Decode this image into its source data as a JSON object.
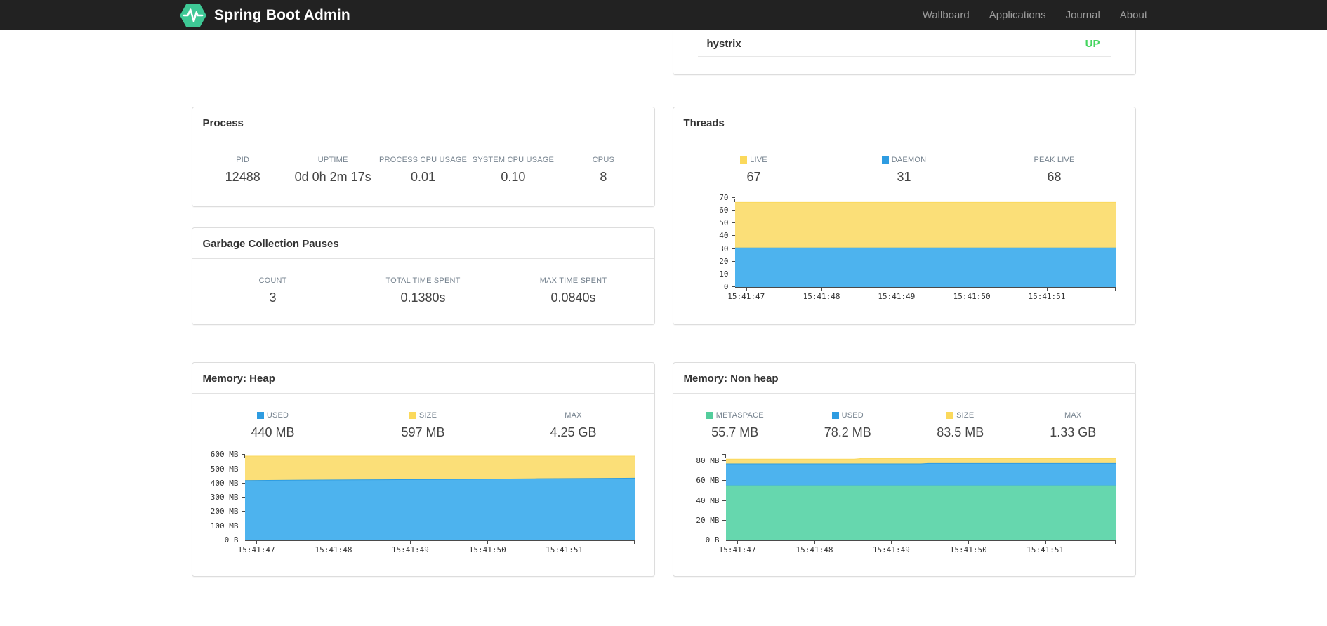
{
  "header": {
    "brand": "Spring Boot Admin",
    "nav": [
      "Wallboard",
      "Applications",
      "Journal",
      "About"
    ]
  },
  "application_panel": {
    "name": "hystrix",
    "status": "UP",
    "status_color": "#45d55f"
  },
  "colors": {
    "navbar_bg": "#222222",
    "brand_green": "#3ec895",
    "status_up": "#45d55f",
    "swatch_yellow": "#fbd95c",
    "swatch_blue": "#2e9ce1",
    "swatch_green": "#53cd9c",
    "area_yellow": "#fbdf78",
    "area_blue": "#4db3ee",
    "area_green": "#66d7ae"
  },
  "panels": {
    "process": {
      "title": "Process",
      "stats": [
        {
          "label": "PID",
          "value": "12488"
        },
        {
          "label": "UPTIME",
          "value": "0d 0h 2m 17s"
        },
        {
          "label": "PROCESS CPU USAGE",
          "value": "0.01"
        },
        {
          "label": "SYSTEM CPU USAGE",
          "value": "0.10"
        },
        {
          "label": "CPUS",
          "value": "8"
        }
      ]
    },
    "gc": {
      "title": "Garbage Collection Pauses",
      "stats": [
        {
          "label": "COUNT",
          "value": "3"
        },
        {
          "label": "TOTAL TIME SPENT",
          "value": "0.1380s"
        },
        {
          "label": "MAX TIME SPENT",
          "value": "0.0840s"
        }
      ]
    },
    "threads": {
      "title": "Threads",
      "stats": [
        {
          "label": "LIVE",
          "value": "67",
          "swatch": "#fbd95c"
        },
        {
          "label": "DAEMON",
          "value": "31",
          "swatch": "#2e9ce1"
        },
        {
          "label": "PEAK LIVE",
          "value": "68"
        }
      ]
    },
    "heap": {
      "title": "Memory: Heap",
      "stats": [
        {
          "label": "USED",
          "value": "440 MB",
          "swatch": "#2e9ce1"
        },
        {
          "label": "SIZE",
          "value": "597 MB",
          "swatch": "#fbd95c"
        },
        {
          "label": "MAX",
          "value": "4.25 GB"
        }
      ]
    },
    "nonheap": {
      "title": "Memory: Non heap",
      "stats": [
        {
          "label": "METASPACE",
          "value": "55.7 MB",
          "swatch": "#53cd9c"
        },
        {
          "label": "USED",
          "value": "78.2 MB",
          "swatch": "#2e9ce1"
        },
        {
          "label": "SIZE",
          "value": "83.5 MB",
          "swatch": "#fbd95c"
        },
        {
          "label": "MAX",
          "value": "1.33 GB"
        }
      ]
    }
  },
  "chart_data": [
    {
      "id": "threads",
      "title": "Threads",
      "type": "area",
      "stacked": true,
      "legend_position": "top",
      "grid": false,
      "x_ticks": [
        "15:41:47",
        "15:41:48",
        "15:41:49",
        "15:41:50",
        "15:41:51"
      ],
      "x_tick_fractions": [
        0.03,
        0.228,
        0.425,
        0.623,
        0.82
      ],
      "ylim": [
        0,
        70
      ],
      "scale_max": 70,
      "y_ticks": [
        {
          "value": 0,
          "label": "0"
        },
        {
          "value": 10,
          "label": "10"
        },
        {
          "value": 20,
          "label": "20"
        },
        {
          "value": 30,
          "label": "30"
        },
        {
          "value": 40,
          "label": "40"
        },
        {
          "value": 50,
          "label": "50"
        },
        {
          "value": 60,
          "label": "60"
        },
        {
          "value": 70,
          "label": "70"
        }
      ],
      "series": [
        {
          "name": "DAEMON",
          "color": "#4db3ee",
          "stroke": "#2e9ce1",
          "points": [
            [
              0,
              31
            ],
            [
              1,
              31
            ]
          ]
        },
        {
          "name": "LIVE",
          "color": "#fbdf78",
          "stroke": "#fbd95c",
          "points": [
            [
              0,
              67
            ],
            [
              1,
              67
            ]
          ]
        }
      ]
    },
    {
      "id": "memory-heap",
      "title": "Memory: Heap",
      "type": "area",
      "stacked": true,
      "legend_position": "top",
      "grid": false,
      "x_ticks": [
        "15:41:47",
        "15:41:48",
        "15:41:49",
        "15:41:50",
        "15:41:51"
      ],
      "x_tick_fractions": [
        0.03,
        0.228,
        0.425,
        0.623,
        0.82
      ],
      "ylim": [
        0,
        612
      ],
      "scale_max": 612,
      "y_ticks": [
        {
          "value": 0,
          "label": "0 B"
        },
        {
          "value": 100,
          "label": "100 MB"
        },
        {
          "value": 200,
          "label": "200 MB"
        },
        {
          "value": 300,
          "label": "300 MB"
        },
        {
          "value": 400,
          "label": "400 MB"
        },
        {
          "value": 500,
          "label": "500 MB"
        },
        {
          "value": 600,
          "label": "600 MB"
        }
      ],
      "series": [
        {
          "name": "USED",
          "color": "#4db3ee",
          "stroke": "#2e9ce1",
          "points": [
            [
              0,
              424
            ],
            [
              0.15,
              427
            ],
            [
              0.35,
              430
            ],
            [
              0.55,
              433
            ],
            [
              0.75,
              437
            ],
            [
              0.9,
              439
            ],
            [
              1,
              441
            ]
          ]
        },
        {
          "name": "SIZE",
          "color": "#fbdf78",
          "stroke": "#fbd95c",
          "points": [
            [
              0,
              597
            ],
            [
              1,
              597
            ]
          ]
        }
      ]
    },
    {
      "id": "memory-nonheap",
      "title": "Memory: Non heap",
      "type": "area",
      "stacked": true,
      "legend_position": "top",
      "grid": false,
      "x_ticks": [
        "15:41:47",
        "15:41:48",
        "15:41:49",
        "15:41:50",
        "15:41:51"
      ],
      "x_tick_fractions": [
        0.03,
        0.228,
        0.425,
        0.623,
        0.82
      ],
      "ylim": [
        0,
        88
      ],
      "scale_max": 88,
      "y_ticks": [
        {
          "value": 0,
          "label": "0 B"
        },
        {
          "value": 20,
          "label": "20 MB"
        },
        {
          "value": 40,
          "label": "40 MB"
        },
        {
          "value": 60,
          "label": "60 MB"
        },
        {
          "value": 80,
          "label": "80 MB"
        }
      ],
      "series": [
        {
          "name": "METASPACE",
          "color": "#66d7ae",
          "stroke": "#53cd9c",
          "points": [
            [
              0,
              55.7
            ],
            [
              1,
              55.7
            ]
          ]
        },
        {
          "name": "USED",
          "color": "#4db3ee",
          "stroke": "#2e9ce1",
          "points": [
            [
              0,
              78
            ],
            [
              0.5,
              78
            ],
            [
              0.52,
              78.4
            ],
            [
              1,
              78.4
            ]
          ]
        },
        {
          "name": "SIZE",
          "color": "#fbdf78",
          "stroke": "#fbd95c",
          "points": [
            [
              0,
              82.8
            ],
            [
              0.33,
              82.8
            ],
            [
              0.35,
              83.5
            ],
            [
              1,
              83.5
            ]
          ]
        }
      ]
    }
  ]
}
